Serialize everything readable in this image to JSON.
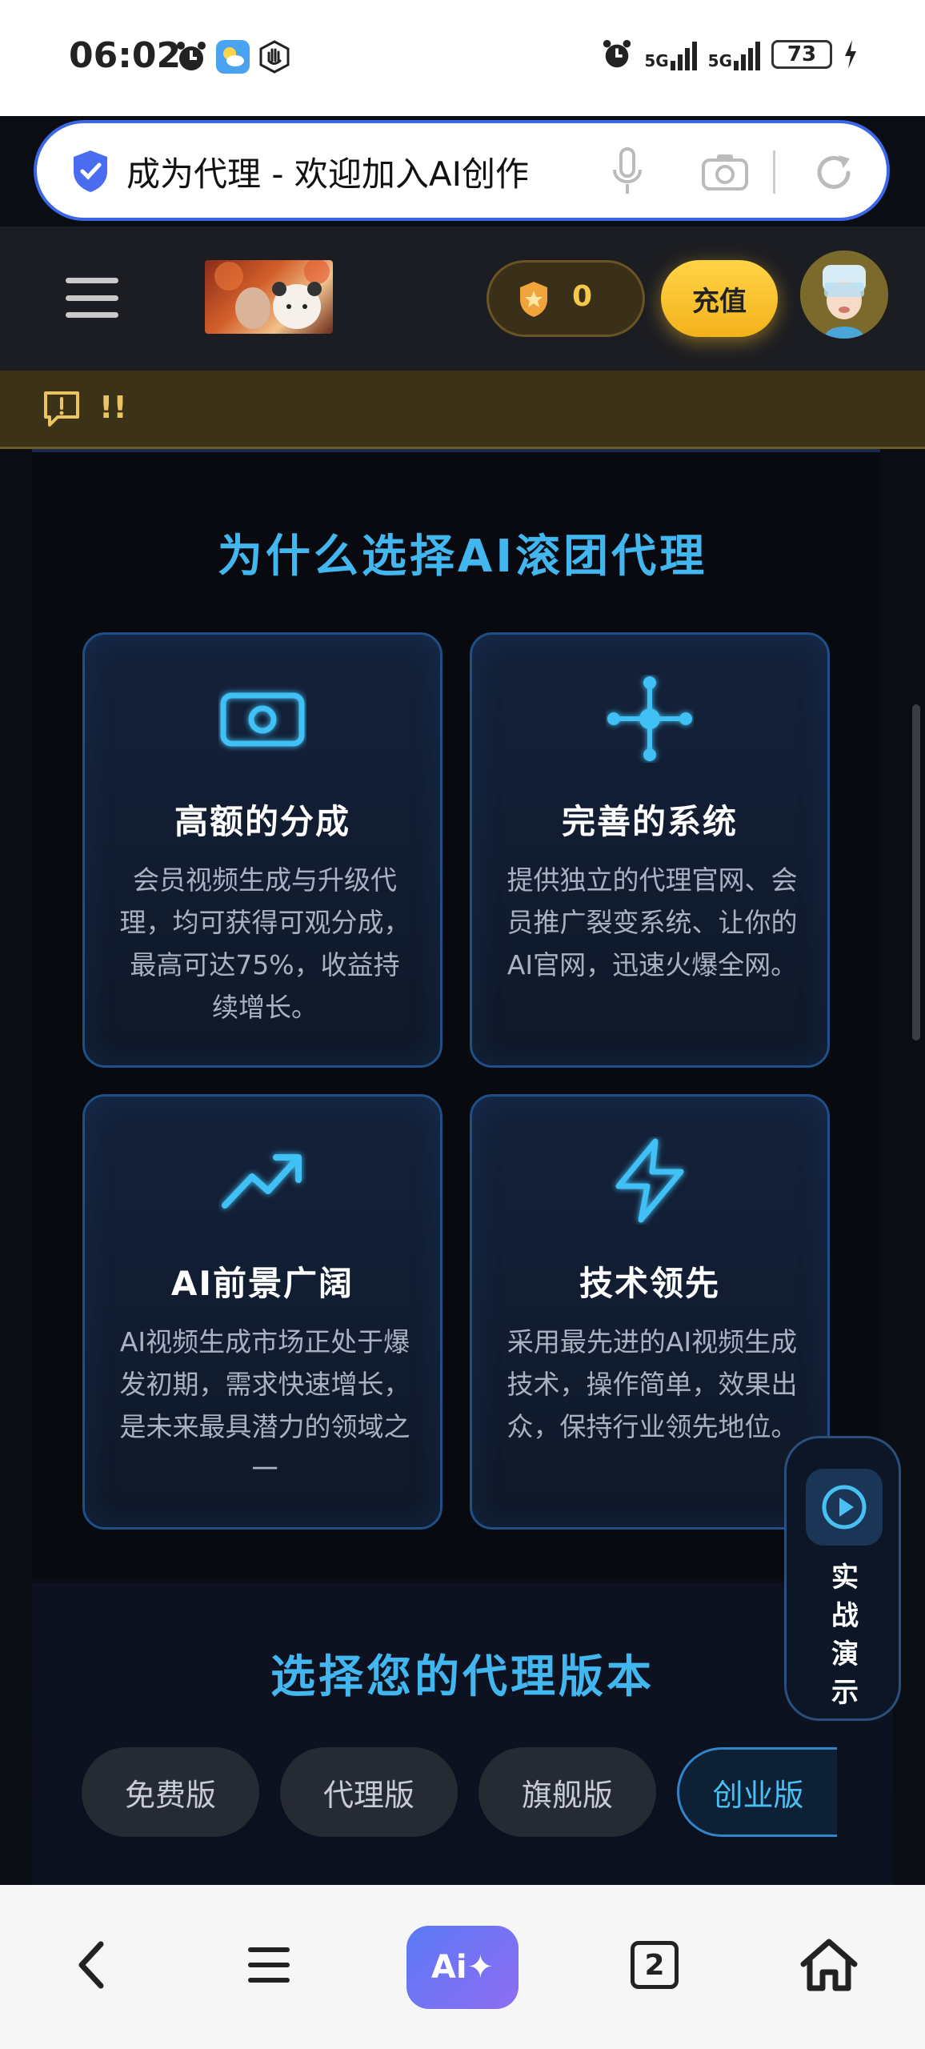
{
  "status": {
    "time": "06:02",
    "network1": "5G",
    "network2": "5G",
    "battery": "73"
  },
  "url_bar": {
    "title": "成为代理 - 欢迎加入AI创作"
  },
  "header": {
    "coin_count": "0",
    "recharge_label": "充值"
  },
  "notice": {
    "text": "!!"
  },
  "why": {
    "title": "为什么选择AI滚团代理",
    "cards": [
      {
        "icon": "money-icon",
        "title": "高额的分成",
        "desc": "会员视频生成与升级代理，均可获得可观分成，最高可达75%，收益持续增长。"
      },
      {
        "icon": "network-icon",
        "title": "完善的系统",
        "desc": "提供独立的代理官网、会员推广裂变系统、让你的AI官网，迅速火爆全网。"
      },
      {
        "icon": "trending-up-icon",
        "title": "AI前景广阔",
        "desc": "AI视频生成市场正处于爆发初期，需求快速增长，是未来最具潜力的领域之一"
      },
      {
        "icon": "lightning-icon",
        "title": "技术领先",
        "desc": "采用最先进的AI视频生成技术，操作简单，效果出众，保持行业领先地位。"
      }
    ]
  },
  "versions": {
    "title": "选择您的代理版本",
    "tabs": [
      "免费版",
      "代理版",
      "旗舰版",
      "创业版"
    ],
    "active_index": 3
  },
  "floating": {
    "label": "实战演示"
  },
  "bottom_nav": {
    "ai_label": "Ai✦",
    "tab_count": "2"
  }
}
